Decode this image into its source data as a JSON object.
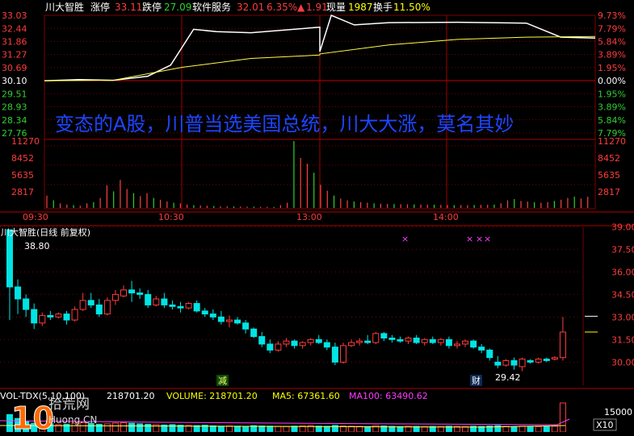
{
  "header": {
    "name": "川大智胜",
    "limit_up_label": "涨停",
    "limit_up_value": "33.11",
    "limit_down_label": "跌停",
    "limit_down_value": "27.09",
    "sector": "软件服务",
    "price": "32.01",
    "change_pct": "6.35%",
    "change_arrow": "▲",
    "change": "1.91",
    "vol_label": "现量",
    "vol_value": "1987",
    "turnover_label": "换手",
    "turnover_value": "11.50%"
  },
  "annotation": "变态的A股，川普当选美国总统，川大大涨，莫名其妙",
  "colors": {
    "up": "#ff3c3c",
    "down": "#00e4e4",
    "vol_up": "#ff4040",
    "vol_down": "#2fd02f",
    "price_line": "#ffffff",
    "avg_line": "#ffff44",
    "ma_line": "#ff3cff",
    "accent_text": "#ffff00",
    "grid": "#7a0000"
  },
  "intraday": {
    "left_prices": [
      "33.03",
      "32.44",
      "31.86",
      "31.27",
      "30.69",
      "30.10",
      "29.51",
      "28.93",
      "28.34",
      "27.76"
    ],
    "right_pcts": [
      "9.73%",
      "7.79%",
      "5.84%",
      "3.89%",
      "1.95%",
      "0.00%",
      "1.95%",
      "3.89%",
      "5.84%",
      "7.79%"
    ],
    "vol_ticks": [
      "11270",
      "8452",
      "5635",
      "2817"
    ],
    "time_ticks": [
      "09:30",
      "10:30",
      "13:00",
      "14:00"
    ],
    "prev_close": 30.1,
    "price_range": [
      27.47,
      33.03
    ]
  },
  "daily": {
    "title": "川大智胜(日线 前复权)",
    "high_note": "38.80",
    "low_note": "29.42",
    "price_ticks": [
      "39.00",
      "37.50",
      "36.00",
      "34.50",
      "33.00",
      "31.50",
      "30.00"
    ],
    "price_range": [
      29.0,
      39.5
    ],
    "badge_jian": "减",
    "badge_cai": "财",
    "stars": [
      "×",
      "×",
      "×",
      "×"
    ]
  },
  "volume_bar": {
    "prefix": "VOL-TDX(5,10,100)",
    "vol_value": "218701.20",
    "volume_text": "VOLUME: 218701.20",
    "ma5_text": "MA5: 67361.60",
    "ma100_text": "MA100: 63490.62",
    "right_tick": "15000",
    "unit": "X10",
    "watermark_num": "10",
    "watermark_cn": "拾荒网",
    "watermark_url": "Huong.CN"
  },
  "chart_data": [
    {
      "type": "line",
      "title": "",
      "series": [
        {
          "x": [
            "09:30",
            "09:45",
            "10:00",
            "10:15",
            "10:25",
            "10:30",
            "10:35",
            "10:45",
            "11:00",
            "11:30",
            "13:00",
            "13:05",
            "13:15",
            "13:30",
            "14:00",
            "14:30",
            "14:45",
            "15:00"
          ],
          "values": [
            30.1,
            30.15,
            30.12,
            30.3,
            30.8,
            31.6,
            32.4,
            32.3,
            32.25,
            32.5,
            31.4,
            33.03,
            32.6,
            32.7,
            32.72,
            32.68,
            32.05,
            32.01
          ]
        },
        {
          "x": [
            "09:30",
            "10:00",
            "10:30",
            "11:00",
            "11:30",
            "13:00",
            "13:30",
            "14:00",
            "14:30",
            "15:00"
          ],
          "values": [
            30.1,
            30.12,
            30.7,
            31.1,
            31.25,
            31.3,
            31.7,
            31.95,
            32.05,
            32.08
          ]
        }
      ],
      "ylim": [
        27.47,
        33.03
      ]
    },
    {
      "type": "bar",
      "title": "",
      "values": [
        2200,
        1400,
        900,
        700,
        600,
        500,
        900,
        1100,
        1800,
        3900,
        2900,
        4800,
        3300,
        2600,
        2100,
        2600,
        1800,
        1500,
        1200,
        1000,
        900,
        700,
        600,
        550,
        500,
        450,
        400,
        400,
        380,
        360,
        350,
        340,
        330,
        320,
        300,
        600,
        1000,
        11270,
        8452,
        7500,
        6000,
        4000,
        3000,
        2200,
        1700,
        1400,
        1200,
        1100,
        1000,
        900,
        850,
        800,
        780,
        760,
        740,
        720,
        700,
        680,
        660,
        640,
        620,
        600,
        600,
        600,
        620,
        640,
        660,
        700,
        900,
        1400,
        1600,
        1300,
        1200,
        1100,
        1000,
        1100,
        1300,
        1500,
        1800,
        2000,
        1700,
        1987
      ],
      "ylim": [
        0,
        11270
      ]
    },
    {
      "type": "bar",
      "title": "",
      "candles": [
        [
          38.8,
          38.8,
          32.8,
          35.0
        ],
        [
          35.0,
          35.5,
          33.2,
          34.2
        ],
        [
          34.2,
          34.5,
          33.0,
          33.5
        ],
        [
          33.5,
          33.9,
          32.2,
          32.6
        ],
        [
          32.6,
          33.3,
          32.4,
          33.1
        ],
        [
          33.1,
          33.4,
          32.8,
          33.0
        ],
        [
          33.0,
          33.3,
          32.9,
          33.2
        ],
        [
          33.2,
          33.4,
          32.5,
          32.8
        ],
        [
          32.8,
          33.7,
          32.7,
          33.5
        ],
        [
          33.5,
          34.6,
          33.4,
          34.1
        ],
        [
          34.1,
          34.6,
          33.6,
          33.8
        ],
        [
          33.8,
          34.2,
          33.0,
          33.2
        ],
        [
          33.2,
          34.3,
          33.1,
          34.1
        ],
        [
          34.1,
          34.8,
          33.8,
          34.5
        ],
        [
          34.4,
          35.1,
          34.3,
          34.8
        ],
        [
          34.8,
          35.4,
          34.0,
          34.6
        ],
        [
          34.6,
          34.9,
          34.2,
          34.5
        ],
        [
          34.5,
          34.8,
          33.6,
          33.8
        ],
        [
          33.8,
          34.4,
          33.7,
          34.2
        ],
        [
          34.2,
          34.6,
          33.6,
          33.8
        ],
        [
          33.8,
          34.1,
          33.5,
          33.7
        ],
        [
          33.7,
          34.0,
          33.3,
          33.6
        ],
        [
          33.6,
          34.0,
          33.5,
          33.9
        ],
        [
          33.9,
          34.1,
          33.3,
          33.4
        ],
        [
          33.4,
          33.6,
          33.0,
          33.2
        ],
        [
          33.2,
          33.5,
          32.8,
          33.0
        ],
        [
          33.0,
          33.4,
          32.5,
          32.7
        ],
        [
          32.7,
          33.1,
          32.3,
          32.8
        ],
        [
          32.8,
          33.0,
          32.5,
          32.6
        ],
        [
          32.6,
          32.8,
          31.9,
          32.2
        ],
        [
          32.2,
          32.3,
          31.6,
          31.7
        ],
        [
          31.7,
          32.0,
          31.0,
          31.2
        ],
        [
          31.2,
          31.5,
          30.6,
          30.8
        ],
        [
          30.8,
          31.4,
          30.7,
          31.2
        ],
        [
          31.2,
          31.6,
          31.0,
          31.4
        ],
        [
          31.4,
          31.5,
          30.9,
          31.1
        ],
        [
          31.1,
          31.4,
          30.9,
          31.3
        ],
        [
          31.3,
          31.6,
          31.1,
          31.5
        ],
        [
          31.5,
          31.8,
          31.2,
          31.3
        ],
        [
          31.3,
          31.5,
          30.8,
          31.0
        ],
        [
          31.0,
          31.3,
          29.8,
          30.0
        ],
        [
          30.0,
          31.3,
          29.9,
          31.1
        ],
        [
          31.1,
          31.5,
          31.0,
          31.3
        ],
        [
          31.3,
          31.6,
          31.1,
          31.4
        ],
        [
          31.4,
          31.8,
          31.2,
          31.3
        ],
        [
          31.3,
          32.0,
          31.2,
          31.9
        ],
        [
          31.9,
          32.0,
          31.4,
          31.6
        ],
        [
          31.6,
          31.8,
          31.3,
          31.5
        ],
        [
          31.5,
          31.7,
          31.3,
          31.4
        ],
        [
          31.4,
          31.7,
          31.2,
          31.6
        ],
        [
          31.6,
          31.8,
          31.2,
          31.3
        ],
        [
          31.3,
          31.6,
          31.1,
          31.5
        ],
        [
          31.5,
          31.7,
          31.2,
          31.3
        ],
        [
          31.3,
          31.6,
          31.1,
          31.5
        ],
        [
          31.5,
          31.7,
          30.9,
          31.1
        ],
        [
          31.1,
          31.4,
          30.9,
          31.2
        ],
        [
          31.2,
          31.5,
          31.0,
          31.4
        ],
        [
          31.4,
          31.5,
          30.9,
          31.0
        ],
        [
          31.0,
          31.2,
          30.6,
          30.8
        ],
        [
          30.8,
          30.9,
          30.1,
          30.3
        ],
        [
          30.0,
          30.4,
          29.6,
          29.8
        ],
        [
          29.8,
          30.2,
          29.7,
          30.1
        ],
        [
          30.1,
          30.3,
          29.5,
          29.8
        ],
        [
          29.7,
          30.3,
          29.4,
          30.2
        ],
        [
          30.1,
          30.2,
          29.9,
          30.0
        ],
        [
          30.0,
          30.3,
          29.9,
          30.2
        ],
        [
          30.2,
          30.3,
          30.0,
          30.1
        ],
        [
          30.2,
          30.4,
          30.1,
          30.3
        ],
        [
          30.3,
          33.0,
          30.1,
          32.0
        ]
      ],
      "ylim": [
        29.0,
        39.5
      ]
    },
    {
      "type": "bar",
      "title": "",
      "values": [
        90,
        70,
        55,
        45,
        40,
        42,
        38,
        40,
        45,
        48,
        44,
        40,
        42,
        46,
        48,
        45,
        42,
        40,
        38,
        36,
        38,
        35,
        34,
        33,
        35,
        32,
        30,
        31,
        30,
        29,
        33,
        31,
        30,
        29,
        28,
        30,
        31,
        33,
        30,
        29,
        34,
        31,
        30,
        29,
        28,
        33,
        31,
        29,
        28,
        30,
        29,
        28,
        29,
        28,
        30,
        29,
        28,
        30,
        29,
        31,
        33,
        29,
        28,
        30,
        29,
        28,
        27,
        30,
        218.7
      ],
      "ylim": [
        0,
        150
      ]
    }
  ]
}
